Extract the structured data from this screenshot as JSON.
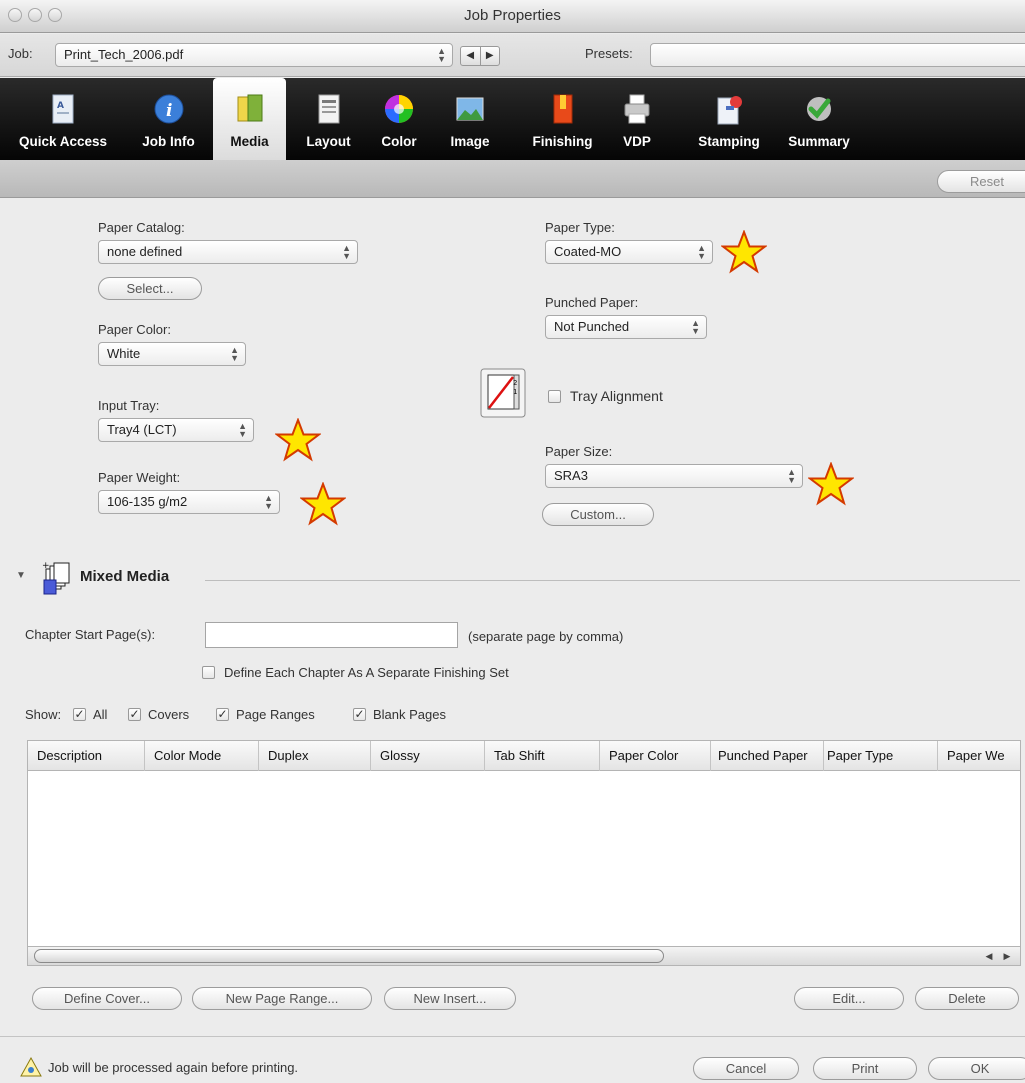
{
  "window": {
    "title": "Job Properties"
  },
  "job": {
    "label": "Job:",
    "value": "Print_Tech_2006.pdf",
    "presets_label": "Presets:",
    "presets_value": ""
  },
  "toolbar": {
    "items": [
      {
        "label": "Quick Access",
        "icon": "quick-access-icon"
      },
      {
        "label": "Job Info",
        "icon": "info-icon"
      },
      {
        "label": "Media",
        "icon": "media-icon"
      },
      {
        "label": "Layout",
        "icon": "layout-icon"
      },
      {
        "label": "Color",
        "icon": "color-wheel-icon"
      },
      {
        "label": "Image",
        "icon": "image-icon"
      },
      {
        "label": "Finishing",
        "icon": "finishing-icon"
      },
      {
        "label": "VDP",
        "icon": "printer-icon"
      },
      {
        "label": "Stamping",
        "icon": "stamp-icon"
      },
      {
        "label": "Summary",
        "icon": "checkmark-icon"
      }
    ],
    "active": "Media"
  },
  "reset_label": "Reset",
  "media": {
    "paper_catalog_label": "Paper Catalog:",
    "paper_catalog_value": "none defined",
    "select_label": "Select...",
    "paper_color_label": "Paper Color:",
    "paper_color_value": "White",
    "input_tray_label": "Input Tray:",
    "input_tray_value": "Tray4 (LCT)",
    "paper_weight_label": "Paper Weight:",
    "paper_weight_value": "106-135 g/m2",
    "paper_type_label": "Paper Type:",
    "paper_type_value": "Coated-MO",
    "punched_label": "Punched Paper:",
    "punched_value": "Not Punched",
    "tray_alignment_label": "Tray Alignment",
    "paper_size_label": "Paper Size:",
    "paper_size_value": "SRA3",
    "custom_label": "Custom..."
  },
  "mixed_media": {
    "title": "Mixed Media",
    "chapter_label": "Chapter Start Page(s):",
    "chapter_value": "",
    "chapter_hint": "(separate page by comma)",
    "define_each_label": "Define Each Chapter As A Separate Finishing Set",
    "show_label": "Show:",
    "show_options": [
      {
        "label": "All",
        "checked": true
      },
      {
        "label": "Covers",
        "checked": true
      },
      {
        "label": "Page Ranges",
        "checked": true
      },
      {
        "label": "Blank Pages",
        "checked": true
      }
    ],
    "columns": [
      "Description",
      "Color Mode",
      "Duplex",
      "Glossy",
      "Tab Shift",
      "Paper Color",
      "Punched Paper",
      "Paper Type",
      "Paper We"
    ],
    "buttons": {
      "define_cover": "Define Cover...",
      "new_page_range": "New Page Range...",
      "new_insert": "New Insert...",
      "edit": "Edit...",
      "delete": "Delete"
    }
  },
  "footer": {
    "status": "Job will be processed again before printing.",
    "cancel": "Cancel",
    "print": "Print",
    "ok": "OK"
  },
  "colors": {
    "toolbar_bg": "#0a0a0a",
    "star_fill": "#ffe600",
    "star_stroke": "#d43a00"
  }
}
